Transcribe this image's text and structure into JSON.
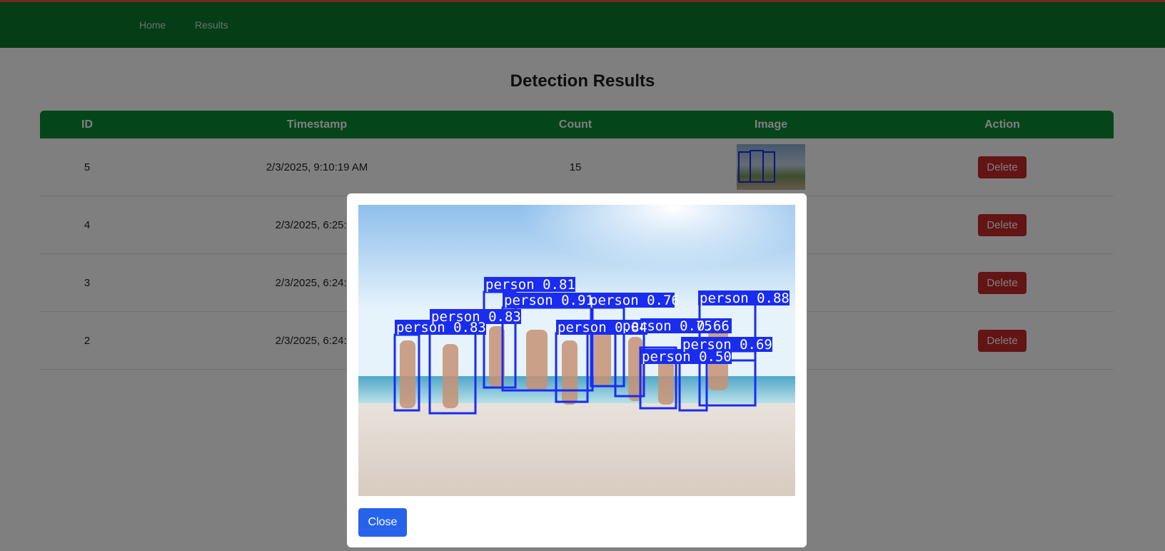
{
  "nav": {
    "home": "Home",
    "results": "Results"
  },
  "page": {
    "title": "Detection Results"
  },
  "table": {
    "headers": [
      "ID",
      "Timestamp",
      "Count",
      "Image",
      "Action"
    ],
    "rows": [
      {
        "id": "5",
        "timestamp": "2/3/2025, 9:10:19 AM",
        "count": "15",
        "action": "Delete"
      },
      {
        "id": "4",
        "timestamp": "2/3/2025, 6:25:19",
        "count": "",
        "action": "Delete"
      },
      {
        "id": "3",
        "timestamp": "2/3/2025, 6:24:57",
        "count": "",
        "action": "Delete"
      },
      {
        "id": "2",
        "timestamp": "2/3/2025, 6:24:35",
        "count": "",
        "action": "Delete"
      }
    ]
  },
  "modal": {
    "close_label": "Close",
    "detections": [
      {
        "label": "person 0.81"
      },
      {
        "label": "person 0.91"
      },
      {
        "label": "person 0.76"
      },
      {
        "label": "person 0.88"
      },
      {
        "label": "person 0.83"
      },
      {
        "label": "person 0.83"
      },
      {
        "label": "person 0.84"
      },
      {
        "label": "person 0.75"
      },
      {
        "label": "0.66"
      },
      {
        "label": "person 0.69"
      },
      {
        "label": "person 0.50"
      }
    ]
  },
  "colors": {
    "navbar": "#0a7a2e",
    "table_header": "#0a8a34",
    "delete": "#c62828",
    "close": "#2563eb",
    "box": "#1a2cf0"
  }
}
